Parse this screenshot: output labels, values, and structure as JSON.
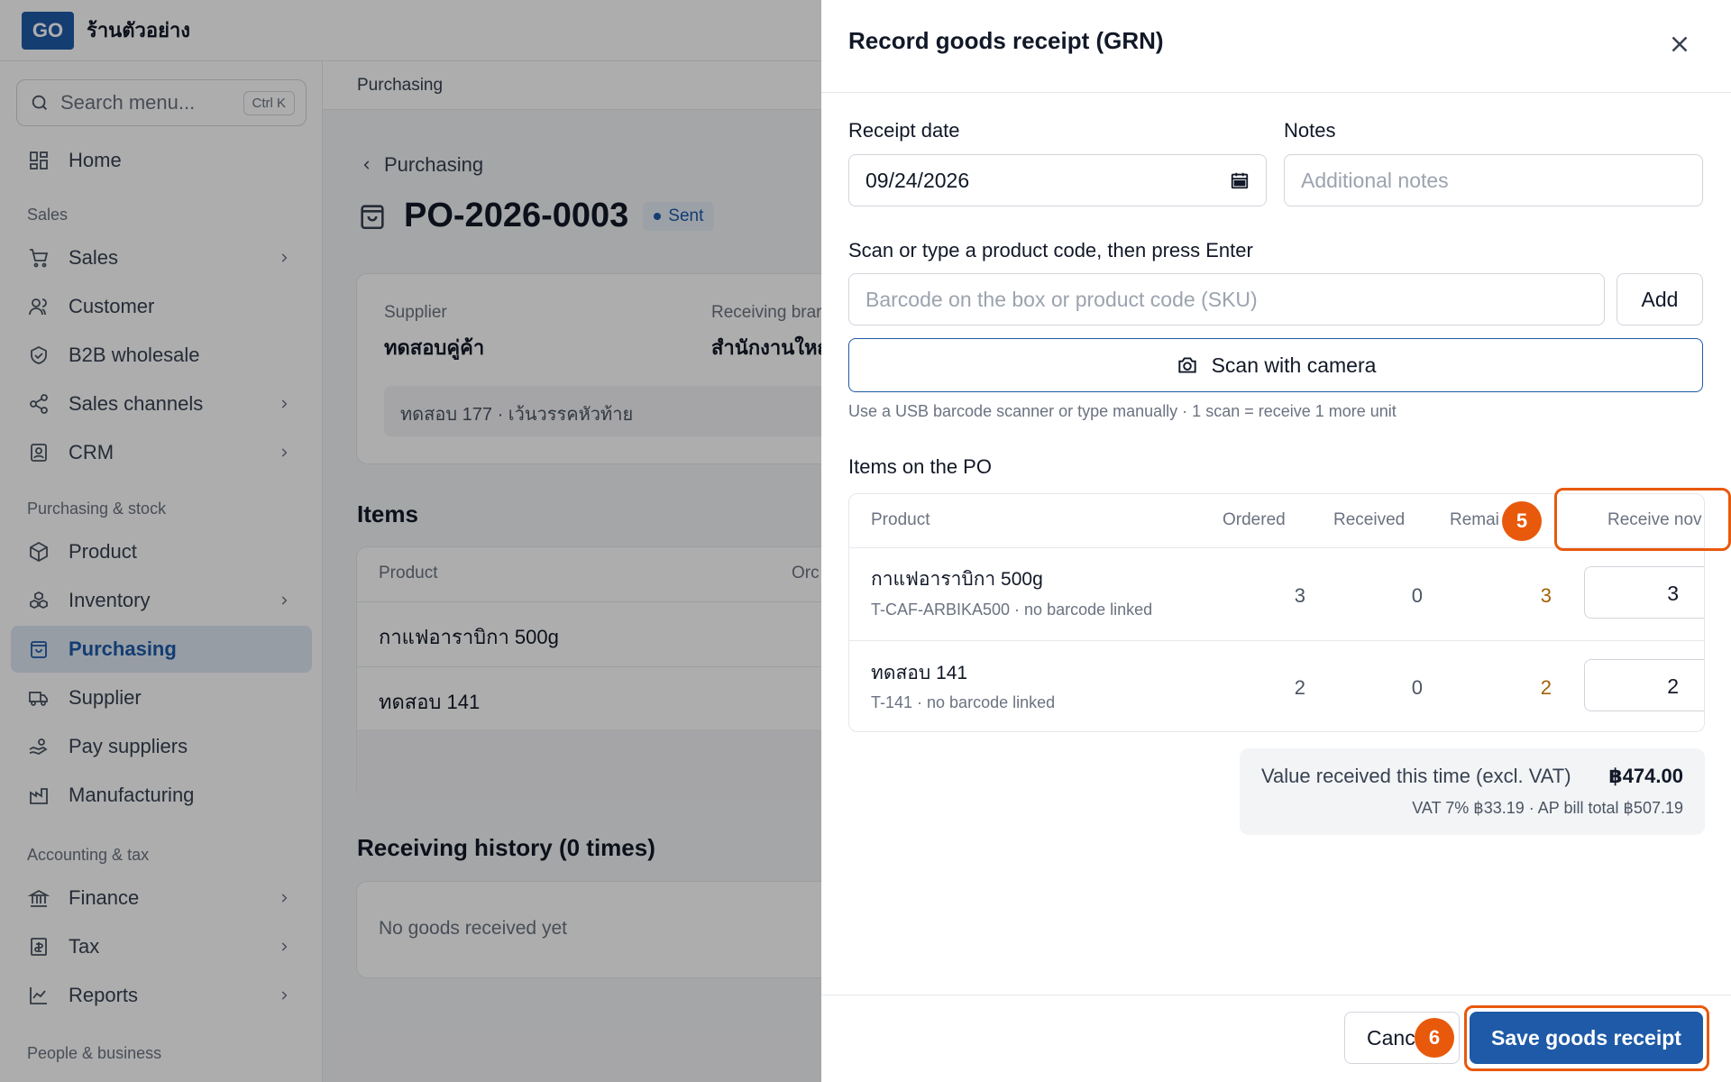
{
  "app": {
    "logo_text": "GO",
    "shop_name": "ร้านตัวอย่าง"
  },
  "sidebar": {
    "search_placeholder": "Search menu...",
    "search_shortcut": "Ctrl K",
    "home": "Home",
    "sections": {
      "sales": "Sales",
      "purchasing_stock": "Purchasing & stock",
      "accounting_tax": "Accounting & tax",
      "people_business": "People & business"
    },
    "items": {
      "sales": "Sales",
      "customer": "Customer",
      "b2b": "B2B wholesale",
      "channels": "Sales channels",
      "crm": "CRM",
      "product": "Product",
      "inventory": "Inventory",
      "purchasing": "Purchasing",
      "supplier": "Supplier",
      "pay_suppliers": "Pay suppliers",
      "manufacturing": "Manufacturing",
      "finance": "Finance",
      "tax": "Tax",
      "reports": "Reports"
    }
  },
  "main": {
    "header": "Purchasing",
    "back_label": "Purchasing",
    "po_number": "PO-2026-0003",
    "status": "Sent",
    "supplier_label": "Supplier",
    "supplier_value": "ทดสอบคู่ค้า",
    "branch_label": "Receiving brar",
    "branch_value": "สำนักงานใหญ",
    "address": "ทดสอบ 177 · เว้นวรรคหัวท้าย",
    "items_title": "Items",
    "items_col_product": "Product",
    "items_col_ordered": "Orc",
    "items": [
      "กาแฟอาราบิกา 500g",
      "ทดสอบ 141"
    ],
    "history_title": "Receiving history (0 times)",
    "history_empty": "No goods received yet"
  },
  "drawer": {
    "title": "Record goods receipt (GRN)",
    "receipt_date_label": "Receipt date",
    "receipt_date_value": "09/24/2026",
    "notes_label": "Notes",
    "notes_placeholder": "Additional notes",
    "scan_label": "Scan or type a product code, then press Enter",
    "scan_placeholder": "Barcode on the box or product code (SKU)",
    "add_button": "Add",
    "camera_button": "Scan with camera",
    "help_text": "Use a USB barcode scanner or type manually · 1 scan = receive 1 more unit",
    "items_label": "Items on the PO",
    "columns": {
      "product": "Product",
      "ordered": "Ordered",
      "received": "Received",
      "remaining": "Remai",
      "receive_now": "Receive nov"
    },
    "rows": [
      {
        "name": "กาแฟอาราบิกา 500g",
        "sub": "T-CAF-ARBIKA500 · no barcode linked",
        "ordered": "3",
        "received": "0",
        "remaining": "3",
        "receive_now": "3"
      },
      {
        "name": "ทดสอบ 141",
        "sub": "T-141 · no barcode linked",
        "ordered": "2",
        "received": "0",
        "remaining": "2",
        "receive_now": "2"
      }
    ],
    "summary_label": "Value received this time (excl. VAT)",
    "summary_value": "฿474.00",
    "summary_sub": "VAT 7% ฿33.19 · AP bill total ฿507.19",
    "cancel_button": "Canc",
    "save_button": "Save goods receipt"
  },
  "annotations": {
    "step5": "5",
    "step6": "6",
    "highlight_color": "#e8590c"
  },
  "colors": {
    "brand": "#1e5aa8",
    "accent": "#e8590c",
    "remaining": "#a16207"
  }
}
